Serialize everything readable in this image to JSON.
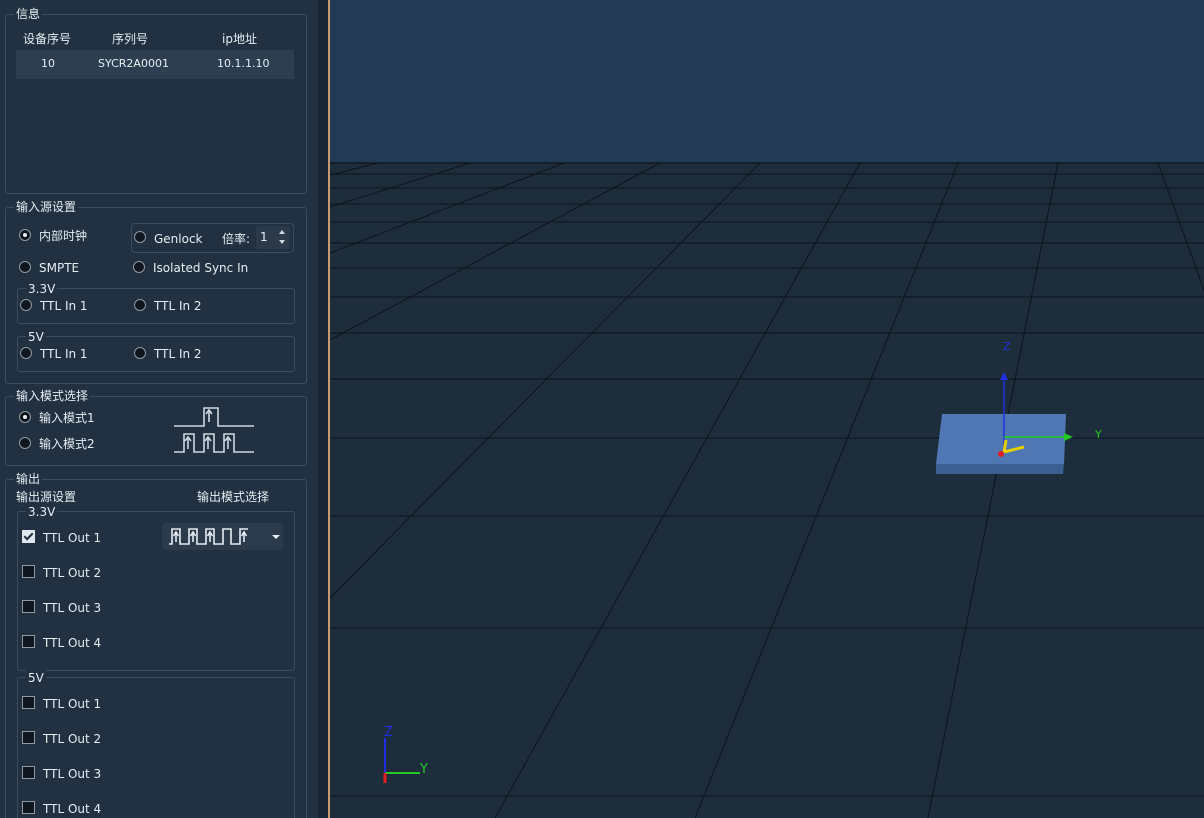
{
  "info": {
    "title": "信息",
    "columns": [
      "设备序号",
      "序列号",
      "ip地址"
    ],
    "rows": [
      {
        "index": "10",
        "serial": "SYCR2A0001",
        "ip": "10.1.1.10"
      }
    ]
  },
  "input_source": {
    "title": "输入源设置",
    "internal_clock": "内部时钟",
    "genlock": "Genlock",
    "multiplier_label": "倍率:",
    "multiplier_value": "1",
    "smpte": "SMPTE",
    "isolated_sync_in": "Isolated Sync In",
    "group_3v3": {
      "title": "3.3V",
      "ttl_in_1": "TTL In 1",
      "ttl_in_2": "TTL In 2"
    },
    "group_5v": {
      "title": "5V",
      "ttl_in_1": "TTL In 1",
      "ttl_in_2": "TTL In 2"
    },
    "selected": "internal_clock"
  },
  "input_mode": {
    "title": "输入模式选择",
    "mode1": "输入模式1",
    "mode2": "输入模式2",
    "selected": "mode1"
  },
  "output": {
    "title": "输出",
    "source_settings": "输出源设置",
    "mode_select": "输出模式选择",
    "group_3v3": {
      "title": "3.3V",
      "items": [
        {
          "label": "TTL Out 1",
          "checked": true
        },
        {
          "label": "TTL Out 2",
          "checked": false
        },
        {
          "label": "TTL Out 3",
          "checked": false
        },
        {
          "label": "TTL Out 4",
          "checked": false
        }
      ]
    },
    "group_5v": {
      "title": "5V",
      "items": [
        {
          "label": "TTL Out 1",
          "checked": false
        },
        {
          "label": "TTL Out 2",
          "checked": false
        },
        {
          "label": "TTL Out 3",
          "checked": false
        },
        {
          "label": "TTL Out 4",
          "checked": false
        }
      ]
    }
  },
  "viewport": {
    "object_axis_labels": {
      "z": "Z",
      "y": "Y"
    },
    "corner_axis_labels": {
      "z": "Z",
      "y": "Y"
    },
    "colors": {
      "x_axis": "#e02020",
      "y_axis": "#22cc22",
      "z_axis": "#2030e0",
      "board": "#4f77b3",
      "sky": "#233a54",
      "floor": "#1e2d3c",
      "accent_splitter": "#c49a72"
    }
  }
}
